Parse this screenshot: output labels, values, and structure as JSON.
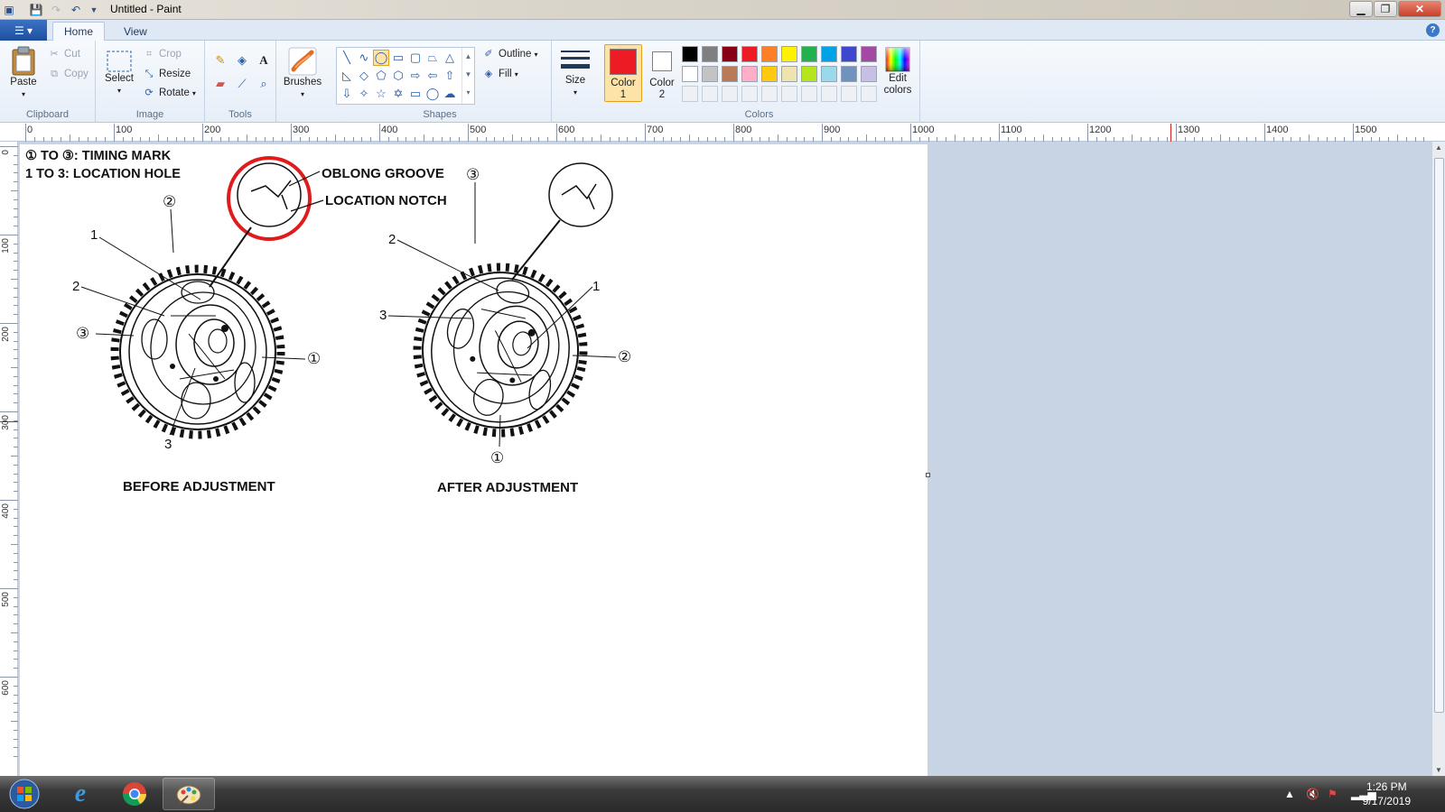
{
  "window": {
    "title": "Untitled - Paint"
  },
  "tabs": {
    "home": "Home",
    "view": "View",
    "help": "?"
  },
  "clipboard": {
    "paste": "Paste",
    "cut": "Cut",
    "copy": "Copy",
    "label": "Clipboard"
  },
  "image": {
    "select": "Select",
    "crop": "Crop",
    "resize": "Resize",
    "rotate": "Rotate",
    "label": "Image"
  },
  "tools": {
    "label": "Tools",
    "text_tool": "A"
  },
  "brushes": {
    "label": "Brushes"
  },
  "shapes": {
    "outline": "Outline",
    "fill": "Fill",
    "label": "Shapes"
  },
  "size": {
    "label": "Size"
  },
  "colors": {
    "color1_label": "Color 1",
    "color1_value": "#ed1c24",
    "color2_label": "Color 2",
    "color2_value": "#ffffff",
    "edit_label": "Edit colors",
    "label": "Colors",
    "palette_row1": [
      "#000000",
      "#7f7f7f",
      "#880015",
      "#ed1c24",
      "#ff7f27",
      "#fff200",
      "#22b14c",
      "#00a2e8",
      "#3f48cc",
      "#a349a4"
    ],
    "palette_row2": [
      "#ffffff",
      "#c3c3c3",
      "#b97a57",
      "#ffaec9",
      "#ffc90e",
      "#efe4b0",
      "#b5e61d",
      "#99d9ea",
      "#7092be",
      "#c8bfe7"
    ]
  },
  "ruler": {
    "top_ticks": [
      "0",
      "100",
      "200",
      "300",
      "400",
      "500",
      "600",
      "700",
      "800",
      "900",
      "1000",
      "1100",
      "1200",
      "1300",
      "1400",
      "1500"
    ],
    "left_ticks": [
      "0",
      "100",
      "200",
      "300",
      "400",
      "500",
      "600"
    ]
  },
  "drawing": {
    "legend_line1": "① TO ③: TIMING MARK",
    "legend_line2": "1 TO 3: LOCATION HOLE",
    "callout_oblong": "OBLONG GROOVE",
    "callout_notch": "LOCATION NOTCH",
    "caption_before": "BEFORE ADJUSTMENT",
    "caption_after": "AFTER ADJUSTMENT",
    "mark1": "1",
    "mark2": "2",
    "mark3": "3",
    "circ1": "①",
    "circ2": "②",
    "circ3": "③"
  },
  "taskbar": {
    "time": "1:26 PM",
    "date": "9/17/2019"
  }
}
